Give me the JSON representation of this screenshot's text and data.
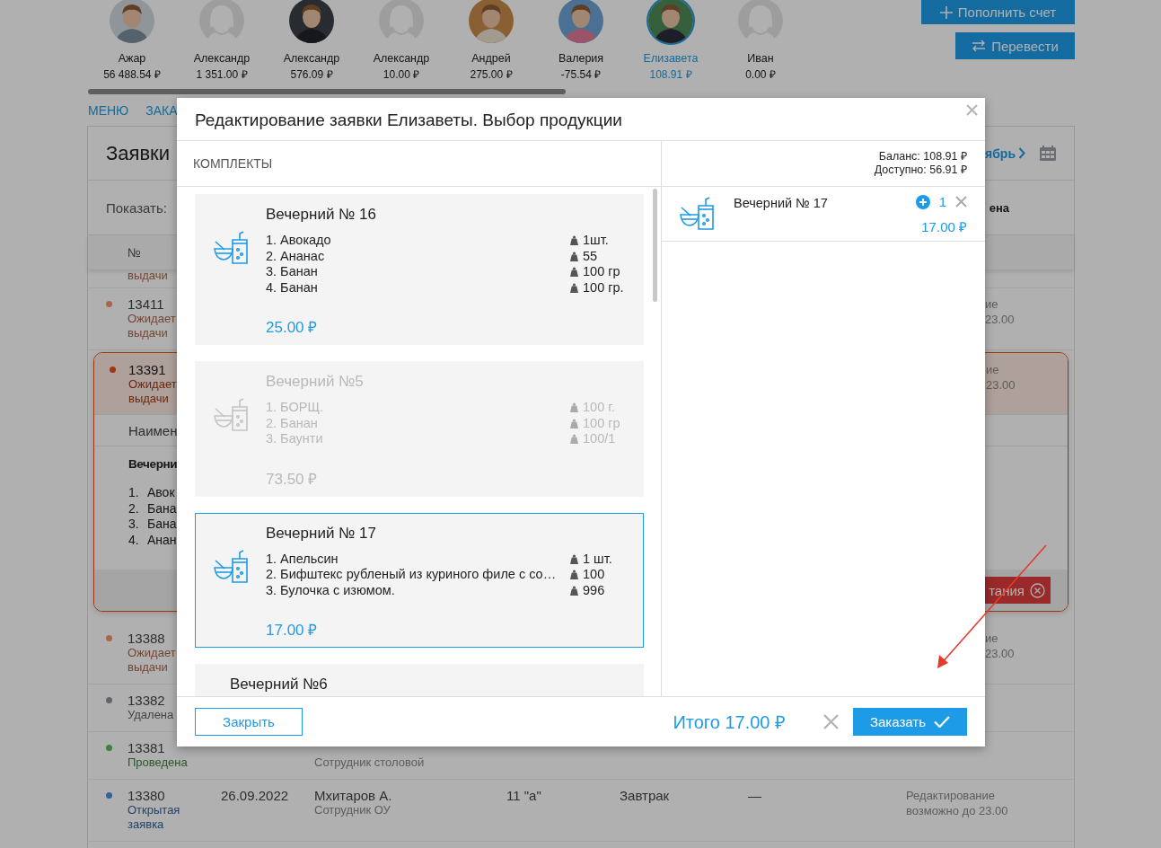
{
  "children_bar": {
    "children": [
      {
        "name": "Ажар",
        "balance": "56 488.54 ₽",
        "selected": false
      },
      {
        "name": "Александр",
        "balance": "1 351.00 ₽",
        "kind": "placeholder",
        "selected": false
      },
      {
        "name": "Александр",
        "balance": "576.09 ₽",
        "selected": false
      },
      {
        "name": "Александр",
        "balance": "10.00 ₽",
        "kind": "placeholder",
        "selected": false
      },
      {
        "name": "Андрей",
        "balance": "275.00 ₽",
        "selected": false
      },
      {
        "name": "Валерия",
        "balance": "-75.54 ₽",
        "selected": false
      },
      {
        "name": "Елизавета",
        "balance": "108.91 ₽",
        "selected": true
      },
      {
        "name": "Иван",
        "balance": "0.00 ₽",
        "kind": "placeholder",
        "selected": false
      }
    ]
  },
  "account_buttons": [
    {
      "kind": "plus",
      "label": "Пополнить счет"
    },
    {
      "kind": "transfer",
      "label": "Перевести"
    }
  ],
  "nav": [
    "МЕНЮ",
    "ЗАКА"
  ],
  "orders_panel": {
    "title": "Заявки",
    "month_fragment": "ябрь",
    "filter_label": "Показать:",
    "filter_fragment": "ена",
    "number_column": "№",
    "top_fragment": "выдачи",
    "rows": [
      {
        "number": "13411",
        "status": "Ожидает выдачи",
        "color": "#a6674c",
        "expanded": false,
        "note_fragment": [
          "ие",
          "23.00"
        ]
      },
      {
        "number": "13391",
        "status": "Ожидает выдачи",
        "color": "#9d3713",
        "expanded": true,
        "note_fragment": [
          "ие",
          "23.00"
        ],
        "details": {
          "column_fragment": "Наимен",
          "set_fragment": "Вечерни",
          "items": [
            {
              "n": "1.",
              "text": "Авок"
            },
            {
              "n": "2.",
              "text": "Бана"
            },
            {
              "n": "3.",
              "text": "Бана"
            },
            {
              "n": "4.",
              "text": "Анан"
            }
          ],
          "button_fragment": "тания"
        }
      },
      {
        "number": "13388",
        "status": "Ожидает выдачи",
        "color": "#a6674c",
        "expanded": false,
        "note_fragment": [
          "ие",
          "23.00"
        ]
      },
      {
        "number": "13382",
        "status": "Удалена",
        "color": "#61656c",
        "expanded": false
      },
      {
        "number": "13381",
        "status": "Проведена",
        "color": "#3f7f3f",
        "expanded": false,
        "role": "Сотрудник столовой"
      },
      {
        "number": "13380",
        "status": "Открытая заявка",
        "color": "#336396",
        "expanded": false,
        "date": "26.09.2022",
        "name": "Мхитаров А.",
        "role": "Сотрудник ОУ",
        "class": "11 \"а\"",
        "meal": "Завтрак",
        "sum": "—",
        "note": "Редактирование возможно до 23.00"
      }
    ]
  },
  "modal": {
    "title": "Редактирование заявки Елизаветы. Выбор продукции",
    "section": "КОМПЛЕКТЫ",
    "balance": "Баланс: 108.91 ₽",
    "available": "Доступно: 56.91 ₽",
    "sets": [
      {
        "title": "Вечерний № 16",
        "disabled": false,
        "selected": false,
        "price": "25.00 ₽",
        "items": [
          {
            "name": "1. Авокадо",
            "weight": "1шт."
          },
          {
            "name": "2. Ананас",
            "weight": "55"
          },
          {
            "name": "3. Банан",
            "weight": "100 гр"
          },
          {
            "name": "4. Банан",
            "weight": "100 гр."
          }
        ]
      },
      {
        "title": "Вечерний №5",
        "disabled": true,
        "selected": false,
        "price": "73.50 ₽",
        "items": [
          {
            "name": "1. БОРЩ.",
            "weight": "100 г."
          },
          {
            "name": "2. Банан",
            "weight": "100 гр"
          },
          {
            "name": "3. Баунти",
            "weight": "100/1"
          }
        ]
      },
      {
        "title": "Вечерний № 17",
        "disabled": false,
        "selected": true,
        "price": "17.00 ₽",
        "items": [
          {
            "name": "1. Апельсин",
            "weight": "1 шт."
          },
          {
            "name": "2. Бифштекс рубленый из куриного филе с со…",
            "weight": "100"
          },
          {
            "name": "3. Булочка с изюмом.",
            "weight": "996"
          }
        ]
      },
      {
        "title": "Вечерний №6",
        "disabled": false,
        "selected": false
      }
    ],
    "cart": [
      {
        "name": "Вечерний № 17",
        "qty": "1",
        "price": "17.00 ₽"
      }
    ],
    "close_button": "Закрыть",
    "total": "Итого 17.00 ₽",
    "order_button": "Заказать"
  }
}
